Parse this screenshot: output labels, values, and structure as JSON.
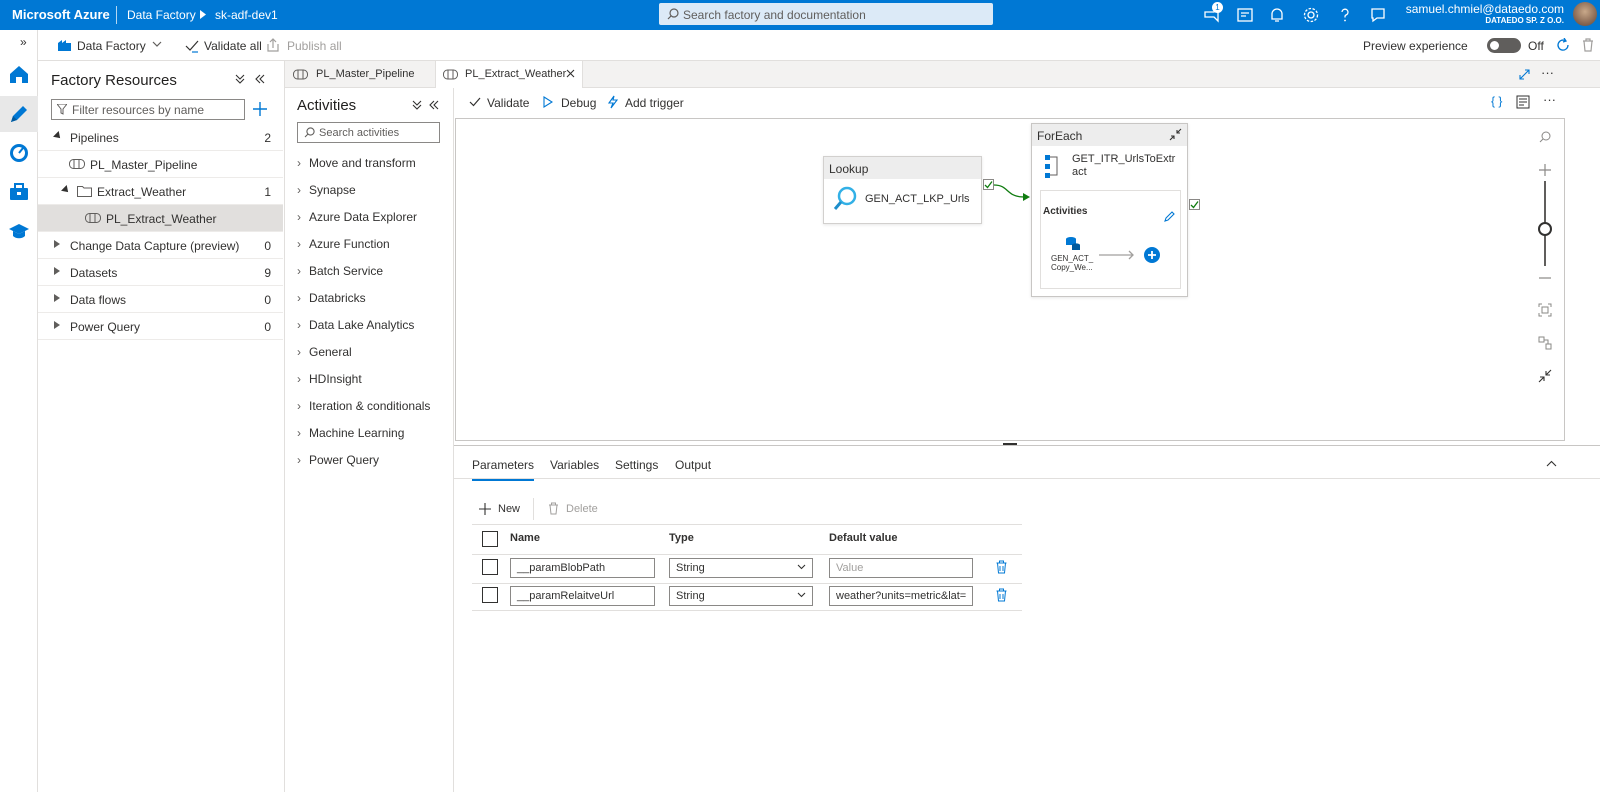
{
  "topbar": {
    "brand": "Microsoft Azure",
    "service": "Data Factory",
    "factory": "sk-adf-dev1",
    "search_placeholder": "Search factory and documentation",
    "notification_count": "1",
    "user_email": "samuel.chmiel@dataedo.com",
    "user_org": "DATAEDO SP. Z O.O.",
    "bg_color": "#0078d4"
  },
  "toolbar": {
    "factory_label": "Data Factory",
    "validate_all": "Validate all",
    "publish_all": "Publish all",
    "preview_label": "Preview experience",
    "toggle_state": "Off"
  },
  "resources": {
    "title": "Factory Resources",
    "filter_placeholder": "Filter resources by name",
    "pipelines": {
      "label": "Pipelines",
      "count": "2"
    },
    "master_pipeline": "PL_Master_Pipeline",
    "folder": {
      "label": "Extract_Weather",
      "count": "1"
    },
    "extract_pipeline": "PL_Extract_Weather",
    "cdc": {
      "label": "Change Data Capture (preview)",
      "count": "0"
    },
    "datasets": {
      "label": "Datasets",
      "count": "9"
    },
    "dataflows": {
      "label": "Data flows",
      "count": "0"
    },
    "powerquery": {
      "label": "Power Query",
      "count": "0"
    }
  },
  "tabs": {
    "tab1": "PL_Master_Pipeline",
    "tab2": "PL_Extract_Weather"
  },
  "activities": {
    "title": "Activities",
    "search_placeholder": "Search activities",
    "items": [
      "Move and transform",
      "Synapse",
      "Azure Data Explorer",
      "Azure Function",
      "Batch Service",
      "Databricks",
      "Data Lake Analytics",
      "General",
      "HDInsight",
      "Iteration & conditionals",
      "Machine Learning",
      "Power Query"
    ]
  },
  "canvas_toolbar": {
    "validate": "Validate",
    "debug": "Debug",
    "add_trigger": "Add trigger"
  },
  "canvas": {
    "lookup": {
      "type": "Lookup",
      "name": "GEN_ACT_LKP_Urls"
    },
    "foreach": {
      "type": "ForEach",
      "name_line1": "GET_ITR_UrlsToExtr",
      "name_line2": "act",
      "activities_label": "Activities",
      "inner_line1": "GEN_ACT_",
      "inner_line2": "Copy_We..."
    }
  },
  "properties": {
    "tabs": [
      "Parameters",
      "Variables",
      "Settings",
      "Output"
    ],
    "new": "New",
    "delete": "Delete",
    "columns": {
      "name": "Name",
      "type": "Type",
      "default": "Default value"
    },
    "rows": [
      {
        "name": "__paramBlobPath",
        "type": "String",
        "default": "",
        "default_placeholder": "Value"
      },
      {
        "name": "__paramRelaitveUrl",
        "type": "String",
        "default": "weather?units=metric&lat=",
        "default_placeholder": ""
      }
    ]
  }
}
